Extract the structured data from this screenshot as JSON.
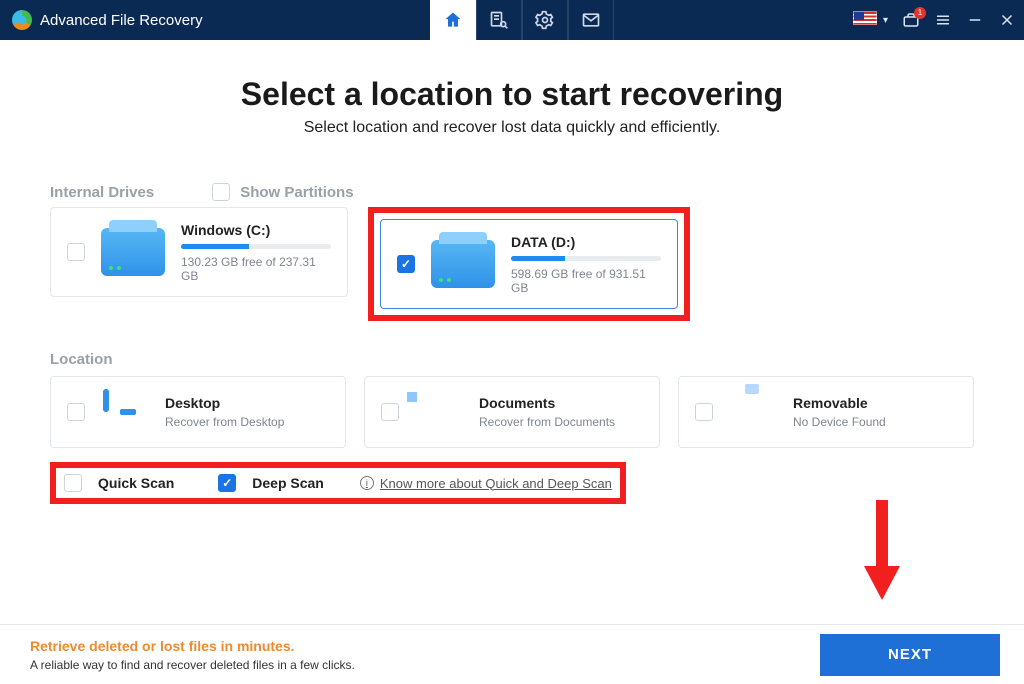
{
  "app": {
    "title": "Advanced File Recovery"
  },
  "titlebar_badge": "1",
  "heading": "Select a location to start recovering",
  "subheading": "Select location and recover lost data quickly and efficiently.",
  "sections": {
    "internal_label": "Internal Drives",
    "show_partitions_label": "Show Partitions",
    "location_label": "Location"
  },
  "drives": [
    {
      "name": "Windows (C:)",
      "free": "130.23 GB free of 237.31 GB",
      "used_pct": 45,
      "selected": false
    },
    {
      "name": "DATA (D:)",
      "free": "598.69 GB free of 931.51 GB",
      "used_pct": 36,
      "selected": true
    }
  ],
  "locations": [
    {
      "name": "Desktop",
      "desc": "Recover from Desktop"
    },
    {
      "name": "Documents",
      "desc": "Recover from Documents"
    },
    {
      "name": "Removable",
      "desc": "No Device Found"
    }
  ],
  "scan": {
    "quick_label": "Quick Scan",
    "deep_label": "Deep Scan",
    "quick_checked": false,
    "deep_checked": true,
    "link_text": "Know more about Quick and Deep Scan"
  },
  "footer": {
    "headline": "Retrieve deleted or lost files in minutes.",
    "desc": "A reliable way to find and recover deleted files in a few clicks.",
    "next": "NEXT"
  }
}
